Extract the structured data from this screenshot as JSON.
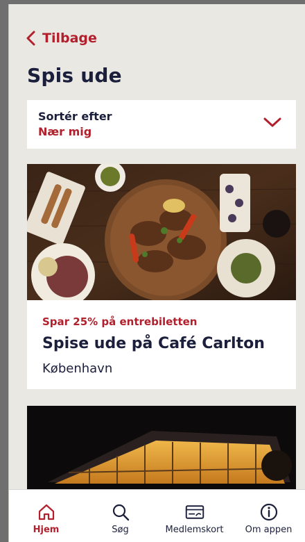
{
  "header": {
    "back_label": "Tilbage",
    "title": "Spis ude"
  },
  "sort": {
    "label": "Sortér efter",
    "value": "Nær mig"
  },
  "cards": [
    {
      "promo": "Spar 25% på entrebiletten",
      "title": "Spise ude på Café Carlton",
      "location": "København"
    }
  ],
  "tabbar": {
    "items": [
      {
        "label": "Hjem",
        "icon": "home-icon",
        "active": true
      },
      {
        "label": "Søg",
        "icon": "search-icon",
        "active": false
      },
      {
        "label": "Medlemskort",
        "icon": "card-icon",
        "active": false
      },
      {
        "label": "Om appen",
        "icon": "info-icon",
        "active": false
      }
    ]
  },
  "colors": {
    "accent": "#b1202c",
    "text": "#1b1f3b",
    "background": "#e9e8e3"
  }
}
